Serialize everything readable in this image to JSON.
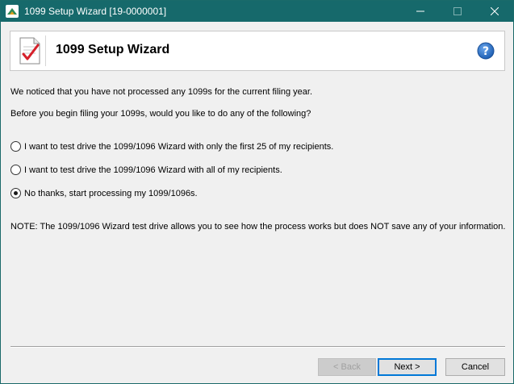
{
  "window": {
    "title": "1099 Setup Wizard [19-0000001]"
  },
  "header": {
    "title": "1099 Setup Wizard",
    "doc_icon": "checklist-document-icon",
    "help_icon": "help-question-icon"
  },
  "body": {
    "notice": "We noticed that you have not processed any 1099s for the current filing year.",
    "prompt": "Before you begin filing your 1099s, would you like to do any of the following?",
    "options": [
      {
        "label": "I want to test drive the 1099/1096 Wizard with only the first 25 of my recipients.",
        "selected": false
      },
      {
        "label": "I want to test drive the 1099/1096 Wizard with all of my recipients.",
        "selected": false
      },
      {
        "label": "No thanks, start processing my 1099/1096s.",
        "selected": true
      }
    ],
    "note": "NOTE: The 1099/1096 Wizard test drive allows you to see how the process works but does NOT save any of your information."
  },
  "footer": {
    "back_label": "< Back",
    "back_enabled": false,
    "next_label": "Next >",
    "cancel_label": "Cancel"
  },
  "colors": {
    "titlebar": "#16696b",
    "accent": "#0078d7",
    "help": "#1e5fb3",
    "checkmark": "#d6202a"
  }
}
